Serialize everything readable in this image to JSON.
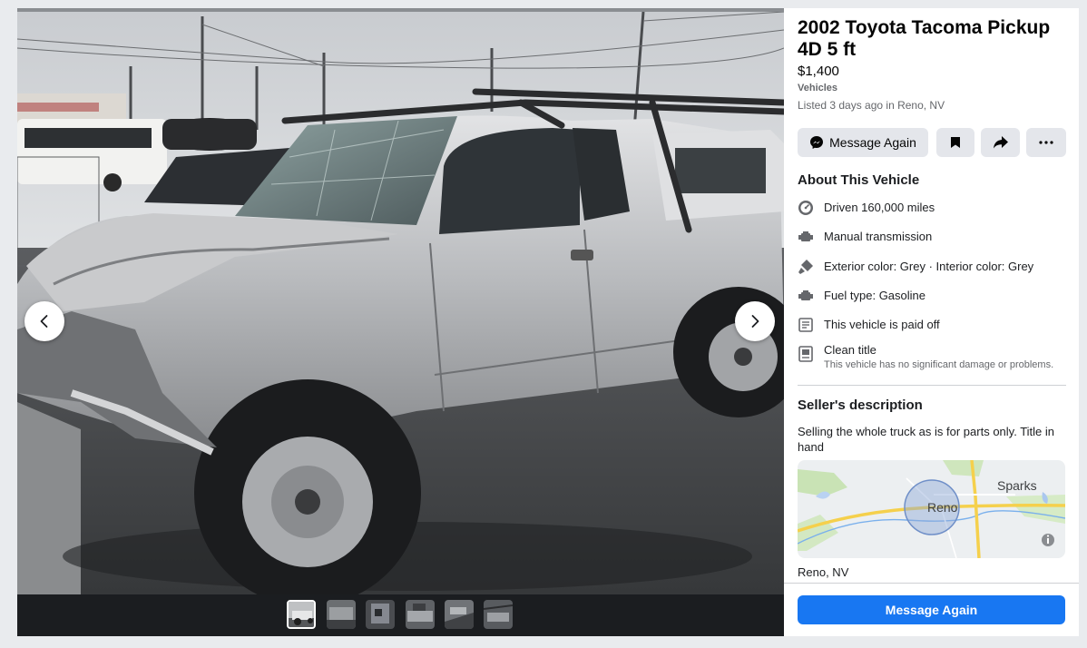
{
  "listing": {
    "title": "2002 Toyota Tacoma Pickup 4D 5 ft",
    "price": "$1,400",
    "category": "Vehicles",
    "listed": "Listed 3 days ago in Reno, NV"
  },
  "actions": {
    "message_label": "Message Again",
    "save_icon": "bookmark-icon",
    "share_icon": "share-arrow-icon",
    "more_icon": "more-dots-icon"
  },
  "about": {
    "heading": "About This Vehicle",
    "items": [
      {
        "icon": "speedometer-icon",
        "text": "Driven 160,000 miles"
      },
      {
        "icon": "engine-icon",
        "text": "Manual transmission"
      },
      {
        "icon": "paint-icon",
        "text": "Exterior color: Grey · Interior color: Grey"
      },
      {
        "icon": "engine-icon",
        "text": "Fuel type: Gasoline"
      },
      {
        "icon": "document-icon",
        "text": "This vehicle is paid off"
      },
      {
        "icon": "title-icon",
        "text": "Clean title",
        "sub": "This vehicle has no significant damage or problems."
      }
    ]
  },
  "seller": {
    "heading": "Seller's description",
    "description": "Selling the whole truck as is for parts only. Title in hand"
  },
  "map": {
    "label_city": "Reno",
    "label_sparks": "Sparks",
    "location": "Reno, NV"
  },
  "footer": {
    "primary_label": "Message Again"
  },
  "gallery": {
    "photo_count": 6,
    "active_index": 0
  },
  "colors": {
    "accent": "#1877f2",
    "button_bg": "#e4e6eb",
    "secondary_text": "#65676b"
  }
}
